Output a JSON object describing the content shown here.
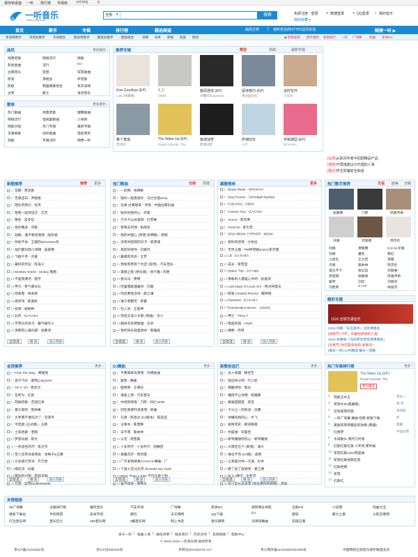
{
  "topbar": {
    "links": [
      "保存到桌面",
      "一听",
      "排行榜",
      "专辑库",
      "HTTPS",
      "9"
    ]
  },
  "logo": {
    "text": "一听音乐",
    "domain": "www.1ting.com"
  },
  "search": {
    "category": "全部",
    "placeholder": "",
    "button": "搜索"
  },
  "header": {
    "login": "免费注册 · 登录",
    "weibo": "微博登录",
    "qq": "QQ登录",
    "my_music": "我的音乐",
    "my_fav": "我的收藏 ▾"
  },
  "nav": {
    "items": [
      "首页",
      "歌手",
      "专辑",
      "排行榜",
      "精选频道"
    ],
    "right": [
      "曲风分类",
      "|",
      "用听安全的HTTPS访问本站",
      "随便一听 ▶"
    ]
  },
  "subnav": {
    "items": [
      "华语男歌手",
      "华语女歌手",
      "华语组合",
      "欧美男歌手",
      "欧美女歌手",
      "欧美组合",
      "日韩",
      "日本",
      "影视",
      "民族",
      "原创"
    ],
    "right": [
      "◆ 新歌速递",
      "歌手推荐",
      "新歌排行",
      "一听",
      "广场舞",
      "戏曲",
      "高清MV"
    ]
  },
  "genre": {
    "title": "曲风",
    "more": "更多曲风 ›",
    "items": [
      "经典老歌",
      "网络流行",
      "情歌",
      "影视金曲",
      "流行",
      "DJ",
      "古典音乐",
      "轻音",
      "军旅歌曲",
      "民谣",
      "演唱会",
      "萨克斯",
      "民歌",
      "韩国偶像组合",
      "有声读物",
      "古筝",
      "爵士",
      "发烧音乐"
    ]
  },
  "playlist": {
    "title": "歌单",
    "more": "更多歌单 ›",
    "items": [
      "热门歌曲",
      "经典老歌",
      "催眠歌曲",
      "网络流行",
      "电视剧歌曲",
      "小清新",
      "情歌对唱",
      "热门专辑",
      "最新专辑",
      "华语男歌",
      "动听歌曲",
      "电影原声",
      "戏剧",
      "专辑试听",
      "随便一听"
    ]
  },
  "recommend": {
    "title": "推荐专辑",
    "tabs": [
      "精选",
      "单曲",
      "最新专辑"
    ],
    "albums": [
      {
        "title": "Kiss Goodbye (EP)",
        "artist": "Lulu (徐璐璐)",
        "color": "#e9e3dc"
      },
      {
        "title": "1_1",
        "artist": "OB03",
        "color": "#c8c9c4"
      },
      {
        "title": "脑洞连体 (EP)",
        "artist": "文馨乐队Sparrow",
        "color": "#2a2a2a"
      },
      {
        "title": "留待楼内 (EP)",
        "artist": "青光园乐队",
        "color": "#7a8a9a"
      },
      {
        "title": "这时花开",
        "artist": "小灰灰",
        "color": "#c9aa8e"
      },
      {
        "title": "某个角落",
        "artist": "苏顶剑",
        "color": "#8a9aa5"
      },
      {
        "title": "The Wake Up (EP)",
        "artist": "Royal Concept, The",
        "color": "#e1c35a"
      },
      {
        "title": "废城谜梦",
        "artist": "废城谜梦",
        "color": "#1d1d1d"
      },
      {
        "title": "庐城旧日",
        "artist": "十六",
        "color": "#bfd6e2"
      },
      {
        "title": "专辑游园 (EP)",
        "artist": "DJ KAKA",
        "color": "#e96b8d"
      }
    ]
  },
  "notices": {
    "items": [
      {
        "tag": "[弘扬]",
        "text": "从民间手册中回顾精品产品"
      },
      {
        "tag": "[通知]",
        "text": "不再接建议分代理的人事"
      },
      {
        "tag": "[警示]",
        "text": "学生防骗安全知道"
      }
    ]
  },
  "lists": {
    "new": {
      "title": "新歌推荐",
      "tabs": [
        "推荐",
        "更多"
      ],
      "songs": [
        "花期 - 芙洛斯",
        "无限宣白 - 尹毓格",
        "陌生的我们 - 忧月",
        "陪我一起到远方 - 艾吉",
        "晚安 - 蓝多哲",
        "给你晚安 - 邓紫",
        "劫数，谁不要说我我 - 陆铃爱",
        "你给不会 - 王嘉韵&GenNeo哥",
        "他们都叫我小溥啊 - 吴嘉豫",
        "飞越千寺 - 许嘉",
        "最好的年纪 - 陈浩义",
        "Monkey World - Hickey 鲁鹏",
        "不是我要的 - 鹿宇",
        "甲方 - 青气暴乐队",
        "简爱者 - 林采斌",
        "诚哥哥 - 陈嘉秋",
        "剪单 - 谢婉婷",
        "北风 - DJ KAKA",
        "学雪乐的孩子 - 瞳气播作人",
        "清肺的心痛乐部 - 张繁诗"
      ]
    },
    "hot": {
      "title": "热门歌曲",
      "tabs": [
        "日榜",
        "周榜"
      ],
      "songs": [
        "一剪梅 - 张晴敏",
        "陪你一起看窗外 - 乌兰托娅army",
        "化缘 古寨唱来 - 罗丽 - 中国古典乐曲",
        "给你你我的心 - 邓紫",
        "万水千山总是情 - 红苹果",
        "寄我去月球 - 张雨生",
        "我的中国心 (原唱 张明敏) - 唐德",
        "没有你陪我的日子 - 郭源诚",
        "真的好想你 - 刘素玲",
        "最美的风声 - 王芳",
        "我和草原有个约定 (现场) - 汽车音乐",
        "美丽之旅 (桥乐版) - 徐千雅 / 刘德",
        "春马马 - 萧明",
        "吃着慢歌遇着你 - 刘嘉",
        "你还要我怎样 - 薛之谦",
        "谁于我都无 - 李睿",
        "在人间 - 王建坤",
        "浪迹天涯三长歌 (单曲) - 辛小",
        "翻身农奴把歌唱 - 云朵",
        "我的快乐就是想你 - 陈雅森"
      ]
    },
    "surge": {
      "title": "飙歌榜单",
      "tabs": [
        "更多"
      ],
      "songs": [
        "Beast Mode - M3SSIAH",
        "Dog Person - Schoolgirl byebye",
        "O BLINGI - OB03",
        "Cosmic Key - DJ KAKA",
        "Venus - 李宗庚",
        "OCEAN - 李大奔",
        "2018 MDSK CYPHER - MDSK",
        "想你的感觉 - 沙依拉",
        "无尽之路 - PM桥琴路&Jerry李杰儒",
        "LB - DJ KAKA",
        "成长 - 蒋雪莹",
        "Space Trip - DJ Halo",
        "勇敢的人都是心中的 - 张嘉诗",
        "Last Days of Louis XIV - 绝对纯音乐",
        "假爱 (US&Oi Remix) - 蘇钟锐",
        "Rainbow - DJ KAKA",
        "Everybody's Movin' - JUNKS",
        "神士 - Tizzy T",
        "我是的骚 - CNdY",
        "偶像 - 丹玥"
      ]
    },
    "member": {
      "title": "会员推荐",
      "more": "更多 ›",
      "songs": [
        "Find The Way - 黄璇瑶",
        "波子汽水 - 雷雨心&yocho",
        "On n' On - 崔凯文",
        "在所为 - 红影",
        "阿嫂的歌 - 吉冠红真",
        "美沙家的 - 我林果",
        "大孝莱不香吗对了 - 刘浪平",
        "半首歌 (正式版) - 王赫",
        "土味地歌 - 老眼",
        "梦游乐瘾 - 陈文",
        "一条遮色的河 - 黑文杰",
        "至少还有你爱我处 - 龙梅子&王娜",
        "只会彼们告诉 - 齐万哈",
        "梅花消 - 乐编",
        "那你的对错 - 蜜钱孚琳",
        "元宝 - 自然Endlesswhite"
      ]
    },
    "dj": {
      "title": "DJ舞曲",
      "more": "更多 ›",
      "songs": [
        "不要再来伤害我 - 刘傅金曲",
        "瘦我 - 舞曲",
        "瘦啊我 - 王律达",
        "请爱上我 - 汽车音乐",
        "中场的惊奇 - 刀郎 - 四比 BOB",
        "别在寂寞时说爱我 - 新曲",
        "兄弟 - 陈淑达 (DJ版本) - 陈奕迅",
        "记事本 - 陈慧琳",
        "日不落 - 蔡依林",
        "火花 - 周慧美",
        "少女时代 - 少女时代 - 劲舞团",
        "春暖花开 - 周华健",
        "广东爱情故事CHACHA舞曲 - 广",
        "下通人在北北市 (Ronald Van Geld",
        "More Than A Kiss 不仅仅是个吻",
        "舍不得你 - 郑秀文"
      ]
    },
    "hotnew": {
      "title": "新歌依选打",
      "more": "更多 ›",
      "songs": [
        "女人如烟 - 韩佳艺",
        "就这样分吧 - 代小武",
        "偶最绿怡 - 蜜焱",
        "懂得不让你错 - 程耀颖",
        "再唱甜甜蜜 - 李佳",
        "干分之一的机会 - 沈康",
        "你懂吗我的心 - 牛飞",
        "爱情完史 - 蔡润萌萌",
        "你是谁 - 邓嘉佳",
        "新琴魔德的伤心 - 新琴魔德",
        "大雨还在下 (新版) - 海大",
        "谁也不完 (DJ版) - 黑雨",
        "让我能对你一次爱 - 杉本",
        "要了爸了就想哭 - 翟江楼",
        "女人1棵子 - 毛凯芬",
        "在小区从此总等 (现在事你的新版) - 高安"
      ]
    },
    "buttons": {
      "all": "全/反选",
      "play": "播 放",
      "add": "加入列表"
    }
  },
  "singers": {
    "title": "热门歌手推荐",
    "tabs": [
      "华语",
      "欧美",
      "日韩"
    ],
    "photos": [
      {
        "name": "张靓颖",
        "color": "#4d5d6b"
      },
      {
        "name": "刀郎",
        "color": "#3a3a3a"
      },
      {
        "name": "凤凰传奇",
        "color": "#a88f7a"
      },
      {
        "name": "许嵩",
        "color": "#cfcfcf"
      },
      {
        "name": "邓紫棋",
        "color": "#6e5644"
      },
      {
        "name": "周杰伦",
        "color": "#e8e4e0"
      }
    ],
    "names": [
      "孙楠",
      "萧敬腾",
      "G.E.M.邓紫",
      "孙楠",
      "董凯",
      "韩红",
      "小虎队",
      "王力宏",
      "李健",
      "许嵩",
      "蔡依林",
      "周杰伦",
      "遗忘不卡",
      "张信哲",
      "邓丽君",
      "周笔畅",
      "梁静茹",
      "凤凰传奇",
      "蔡琴",
      "刘欢",
      "刘德华",
      "刘若英",
      "S.H.E",
      "林俊杰"
    ]
  },
  "special": {
    "title": "精彩专题",
    "banner": "1516 全球华语音乐",
    "items": [
      "2015 孙楠「乐在其中」北京演唱会",
      "[感恩节] 今年，你最想感谢的人是",
      "2015 张惠妹「乌托邦世界巡演演唱会」",
      "[光棍节] 你还是单身狗 单身吗?",
      "[每日一听] 10月精选 每天一首歌"
    ]
  },
  "chart": {
    "title": "热门专辑排行榜",
    "more": "更多 ›",
    "first": {
      "title": "The Wake Up (EP)",
      "artist": "Royal Concept, The",
      "btn": "暂时播放",
      "color": "#e1c35a"
    },
    "rows": [
      "阿歌王中王",
      "梦游水乡(典藏版)",
      "这张是我的歌",
      "一听广场舞 舞曲 经典 新歌下载",
      "美丽的草原最后的动物 (典藏)",
      "红楼梦",
      "水调歌头·明月几时有",
      "红歌红歌红歌 十年经 那时候",
      "军旅红歌1010我是谁",
      "军旅红歌经典百首",
      "红歌经典",
      "军旅",
      "红歌红"
    ],
    "right": [
      "雪乐一",
      "唱 谱",
      "电视剧",
      "新",
      "典藏",
      "中国古典",
      "",
      "",
      "",
      "",
      "",
      "",
      ""
    ]
  },
  "friends": {
    "title": "友情链接",
    "links": [
      "99广场舞",
      "主播排行榜",
      "最时音乐",
      "汽车评测",
      "广场舞",
      "高清MV",
      "搜狗网址导航",
      "企鹅FM",
      "小说网",
      "戏曲大全",
      "捷易下载站",
      "手机网游",
      "安卓市场",
      "魅玩",
      "天天网网",
      "QQ下载",
      "DJ",
      "壁纸",
      "聚力之家",
      "火影忍者网",
      "叮当音乐网",
      "音乐巴士",
      "365音乐网",
      "9酷音乐网",
      "网上书店",
      "音乐网网",
      "深港场舞曲",
      "友链已满"
    ]
  },
  "footer": {
    "links": [
      "关于一听",
      "|",
      "歌曲入库",
      "|",
      "版权声明",
      "|",
      "联系我们",
      "|",
      "历史合作",
      "|",
      "友情链接",
      "|",
      "帮助中心"
    ],
    "copyright": "© 2003-2018 一听音乐网 版权所有",
    "icp": [
      "京ICP备11022602号",
      "京ICP证080320号",
      "京网文[2016]1078-127",
      "京公网安备11010502020469号",
      "中国网络正版音乐保护联盟会员"
    ]
  }
}
